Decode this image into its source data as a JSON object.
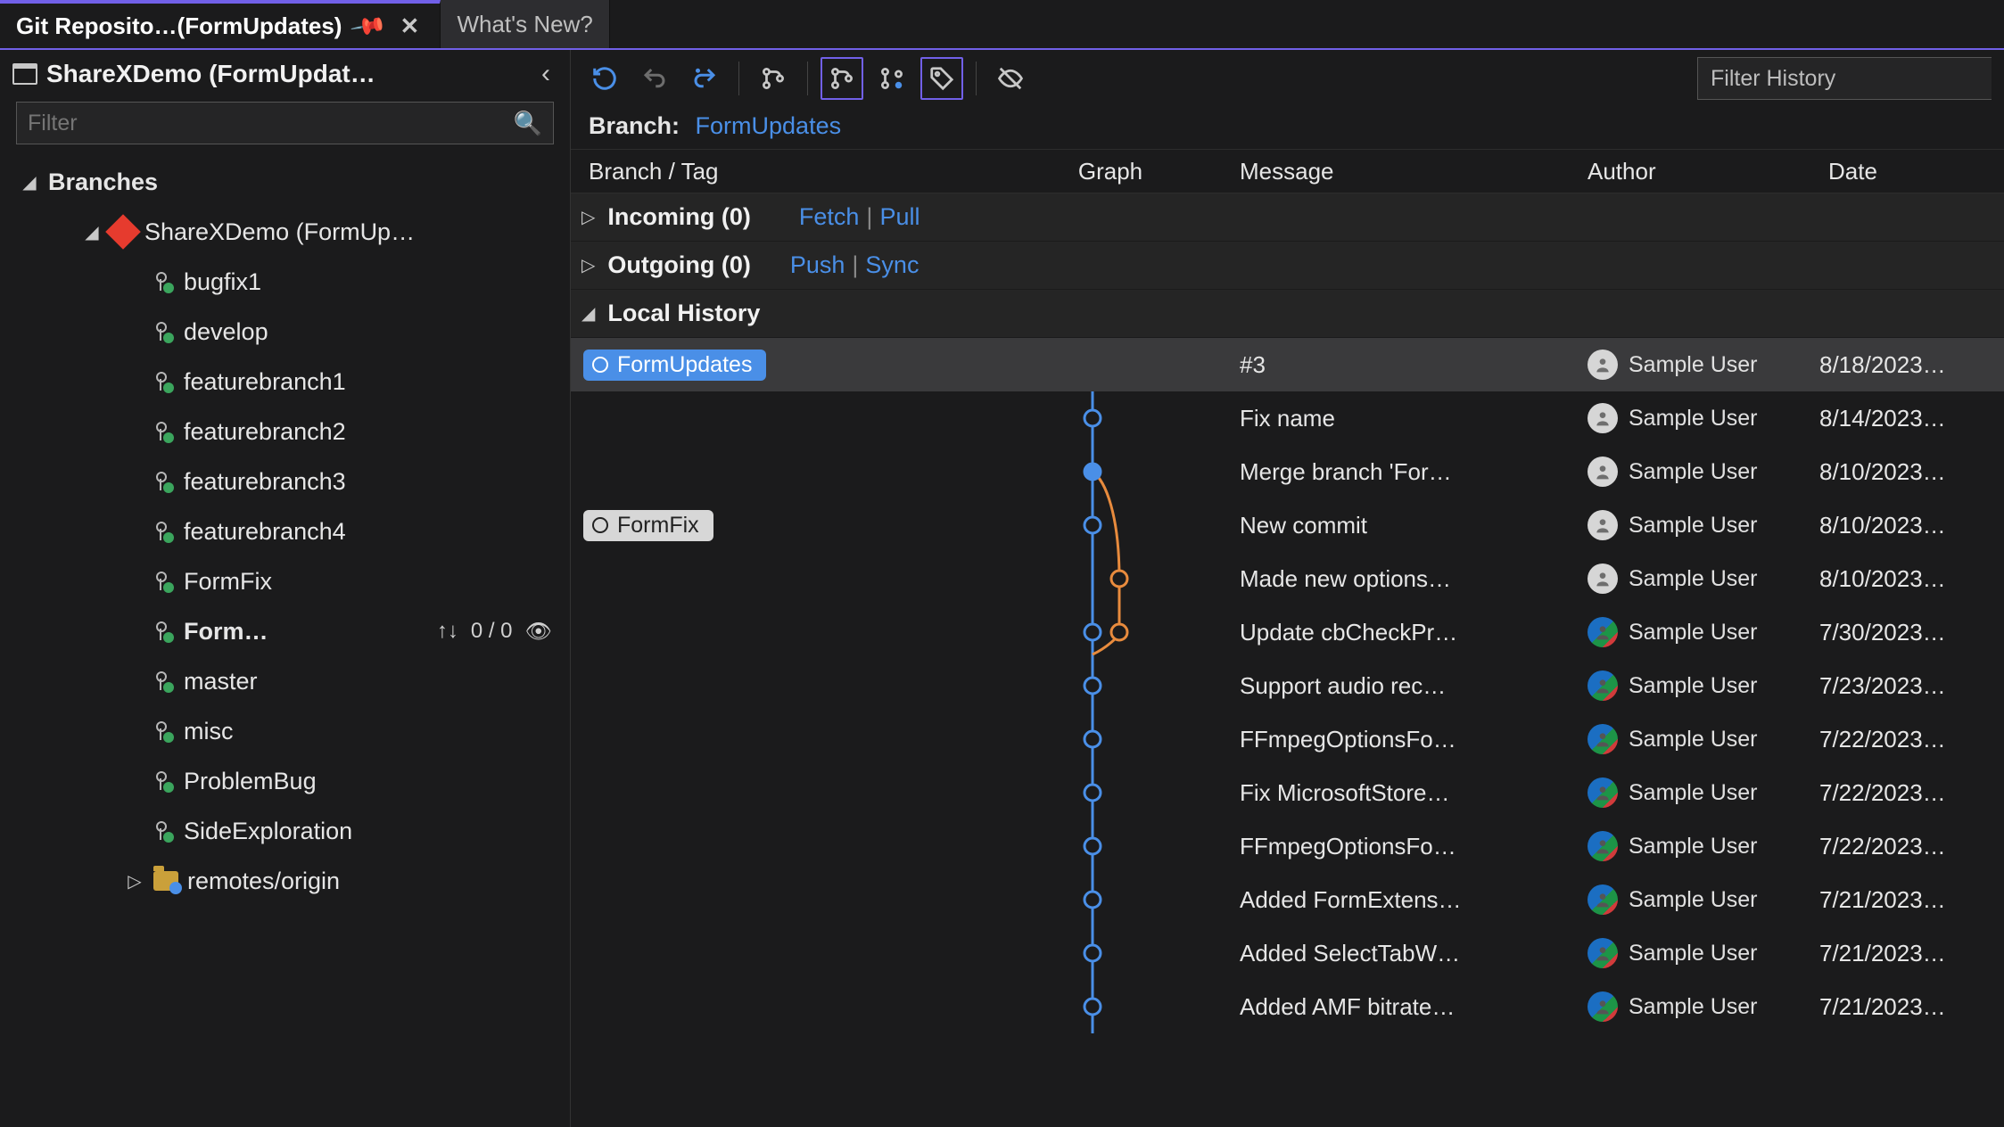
{
  "tabs": {
    "active": "Git Reposito…(FormUpdates)",
    "inactive": "What's New?"
  },
  "sidebar": {
    "title": "ShareXDemo (FormUpdat…",
    "filter_placeholder": "Filter",
    "branches_header": "Branches",
    "repo_label": "ShareXDemo (FormUp…",
    "branches": [
      "bugfix1",
      "develop",
      "featurebranch1",
      "featurebranch2",
      "featurebranch3",
      "featurebranch4",
      "FormFix",
      "Form…",
      "master",
      "misc",
      "ProblemBug",
      "SideExploration"
    ],
    "current_branch_counts": "0 / 0",
    "remotes_label": "remotes/origin"
  },
  "toolbarFilter": "Filter History",
  "branch": {
    "label": "Branch:",
    "value": "FormUpdates"
  },
  "columns": {
    "branch": "Branch / Tag",
    "graph": "Graph",
    "message": "Message",
    "author": "Author",
    "date": "Date"
  },
  "sections": {
    "incoming": {
      "title": "Incoming (0)",
      "link1": "Fetch",
      "link2": "Pull"
    },
    "outgoing": {
      "title": "Outgoing (0)",
      "link1": "Push",
      "link2": "Sync"
    },
    "local": {
      "title": "Local History"
    }
  },
  "tags": {
    "formupdates": "FormUpdates",
    "formfix": "FormFix"
  },
  "commits": [
    {
      "msg": "#3",
      "author": "Sample User",
      "date": "8/18/2023…",
      "avatar": "grey"
    },
    {
      "msg": "Fix name",
      "author": "Sample User",
      "date": "8/14/2023…",
      "avatar": "grey"
    },
    {
      "msg": "Merge branch 'For…",
      "author": "Sample User",
      "date": "8/10/2023…",
      "avatar": "grey"
    },
    {
      "msg": "New commit",
      "author": "Sample User",
      "date": "8/10/2023…",
      "avatar": "grey"
    },
    {
      "msg": "Made new options…",
      "author": "Sample User",
      "date": "8/10/2023…",
      "avatar": "grey"
    },
    {
      "msg": "Update cbCheckPr…",
      "author": "Sample User",
      "date": "7/30/2023…",
      "avatar": "color"
    },
    {
      "msg": "Support audio rec…",
      "author": "Sample User",
      "date": "7/23/2023…",
      "avatar": "color"
    },
    {
      "msg": "FFmpegOptionsFo…",
      "author": "Sample User",
      "date": "7/22/2023…",
      "avatar": "color"
    },
    {
      "msg": "Fix MicrosoftStore…",
      "author": "Sample User",
      "date": "7/22/2023…",
      "avatar": "color"
    },
    {
      "msg": "FFmpegOptionsFo…",
      "author": "Sample User",
      "date": "7/22/2023…",
      "avatar": "color"
    },
    {
      "msg": "Added FormExtens…",
      "author": "Sample User",
      "date": "7/21/2023…",
      "avatar": "color"
    },
    {
      "msg": "Added SelectTabW…",
      "author": "Sample User",
      "date": "7/21/2023…",
      "avatar": "color"
    },
    {
      "msg": "Added AMF bitrate…",
      "author": "Sample User",
      "date": "7/21/2023…",
      "avatar": "color"
    }
  ]
}
